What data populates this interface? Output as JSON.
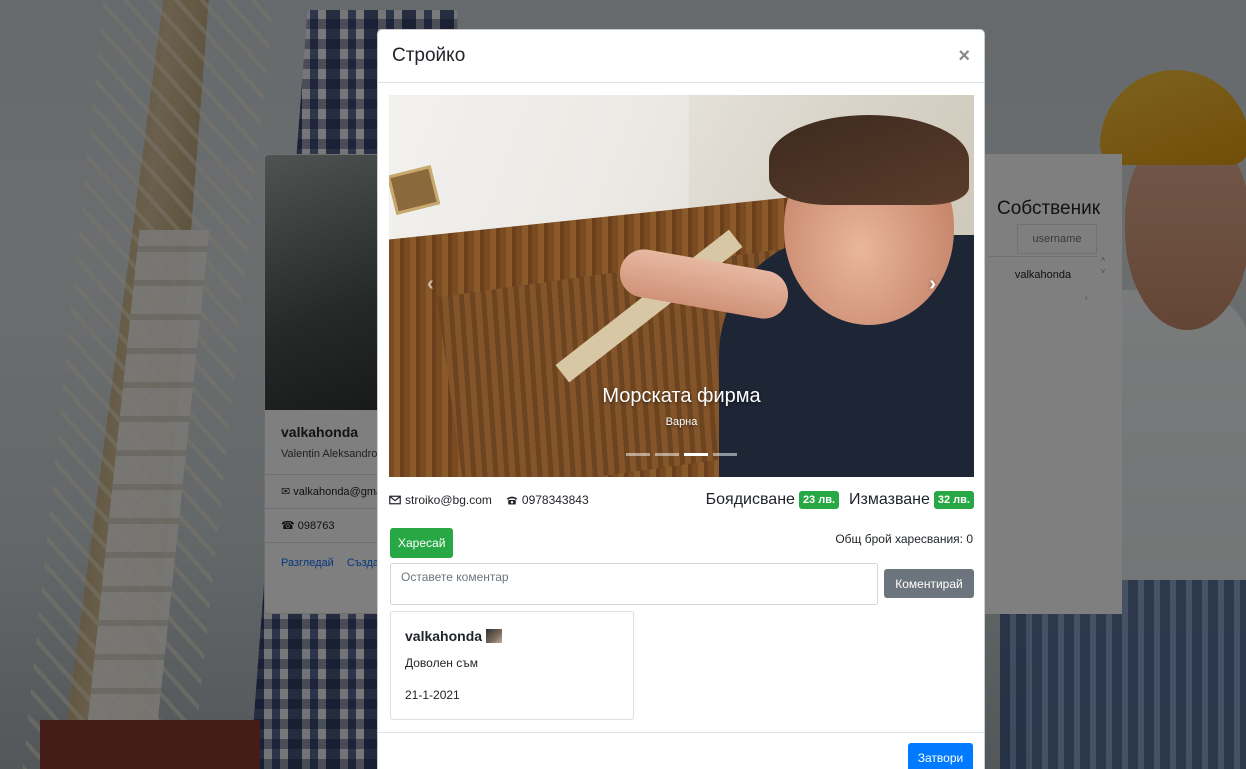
{
  "background": {
    "left_card": {
      "username": "valkahonda",
      "full_name": "Valentin Aleksandrov",
      "email": "valkahonda@gmail.com",
      "phone": "098763",
      "links": [
        "Разгледай",
        "Създай"
      ]
    },
    "right_panel": {
      "title": "Собственик",
      "column_header": "username",
      "cell_value": "valkahonda"
    }
  },
  "modal": {
    "title": "Стройко",
    "close_symbol": "×",
    "carousel": {
      "caption_title": "Морската фирма",
      "caption_subtitle": "Варна",
      "indicator_count": 4,
      "active_indicator": 3,
      "prev_symbol": "‹",
      "next_symbol": "›"
    },
    "contact": {
      "email": "stroiko@bg.com",
      "phone": "0978343843"
    },
    "prices": {
      "painting_label": "Боядисване",
      "painting_price": "23 лв.",
      "plastering_label": "Измазване",
      "plastering_price": "32 лв."
    },
    "like_button": "Харесай",
    "likes_text": "Общ брой харесвания: 0",
    "comment_placeholder": "Оставете коментар",
    "comment_button": "Коментирай",
    "comments": [
      {
        "author": "valkahonda",
        "text": "Доволен съм",
        "date": "21-1-2021"
      }
    ],
    "footer_close_button": "Затвори"
  },
  "colors": {
    "success": "#28a745",
    "primary": "#007bff",
    "secondary": "#6c757d"
  }
}
